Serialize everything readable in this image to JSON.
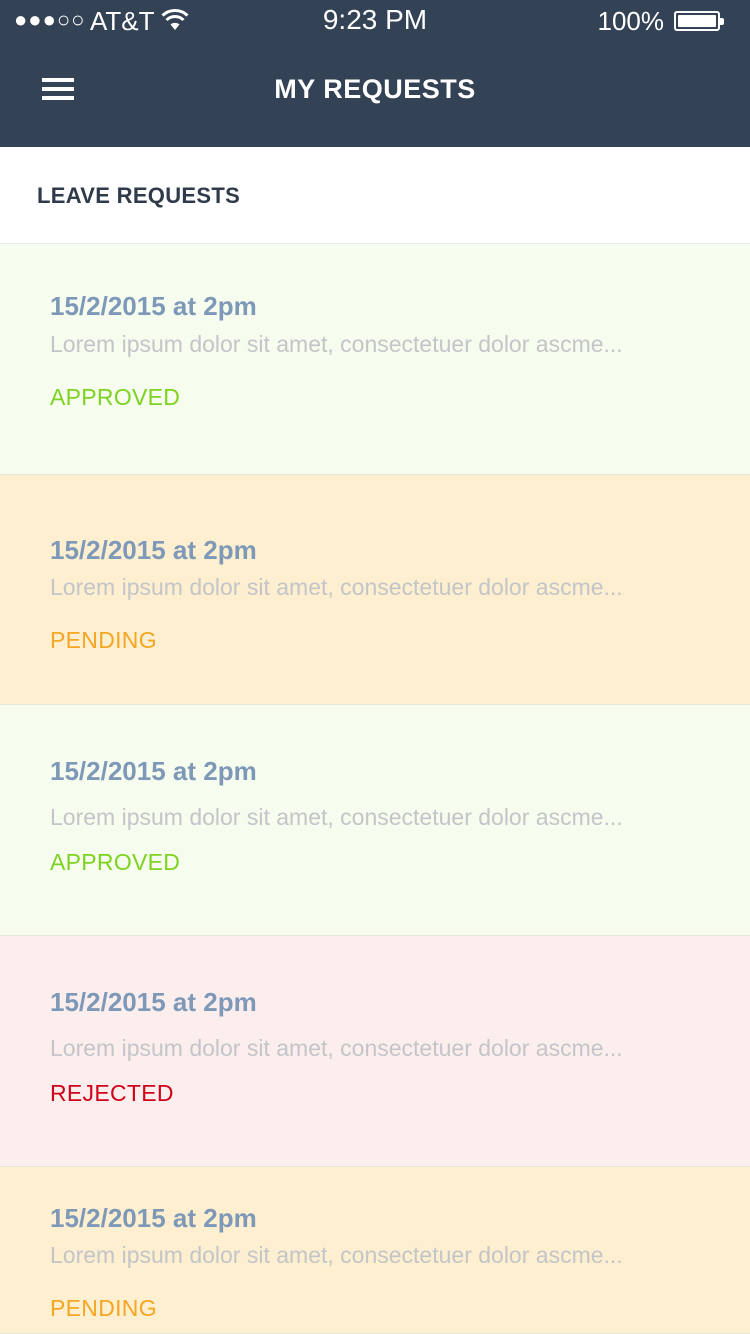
{
  "status_bar": {
    "signal": "●●●○○",
    "carrier": "AT&T",
    "wifi_icon": "wifi-icon",
    "time": "9:23 PM",
    "battery_percent": "100%",
    "battery_icon": "battery-icon"
  },
  "nav": {
    "menu_icon": "hamburger-menu-icon",
    "title": "MY REQUESTS"
  },
  "section": {
    "title": "LEAVE REQUESTS"
  },
  "colors": {
    "nav_background": "#344256",
    "approved_bg": "#f6fcee",
    "approved_text": "#7ed321",
    "pending_bg": "#fdefcf",
    "pending_text": "#f5a623",
    "rejected_bg": "#fdeeee",
    "rejected_text": "#d0021b",
    "date_text": "#7e98b8",
    "desc_text": "#c3c5c8"
  },
  "requests": [
    {
      "date": "15/2/2015 at 2pm",
      "description": "Lorem ipsum dolor sit amet, consectetuer dolor ascme...",
      "status": "APPROVED"
    },
    {
      "date": "15/2/2015 at 2pm",
      "description": "Lorem ipsum dolor sit amet, consectetuer dolor ascme...",
      "status": "PENDING"
    },
    {
      "date": "15/2/2015 at 2pm",
      "description": "Lorem ipsum dolor sit amet, consectetuer dolor ascme...",
      "status": "APPROVED"
    },
    {
      "date": "15/2/2015 at 2pm",
      "description": "Lorem ipsum dolor sit amet, consectetuer dolor ascme...",
      "status": "REJECTED"
    },
    {
      "date": "15/2/2015 at 2pm",
      "description": "Lorem ipsum dolor sit amet, consectetuer dolor ascme...",
      "status": "PENDING"
    }
  ]
}
